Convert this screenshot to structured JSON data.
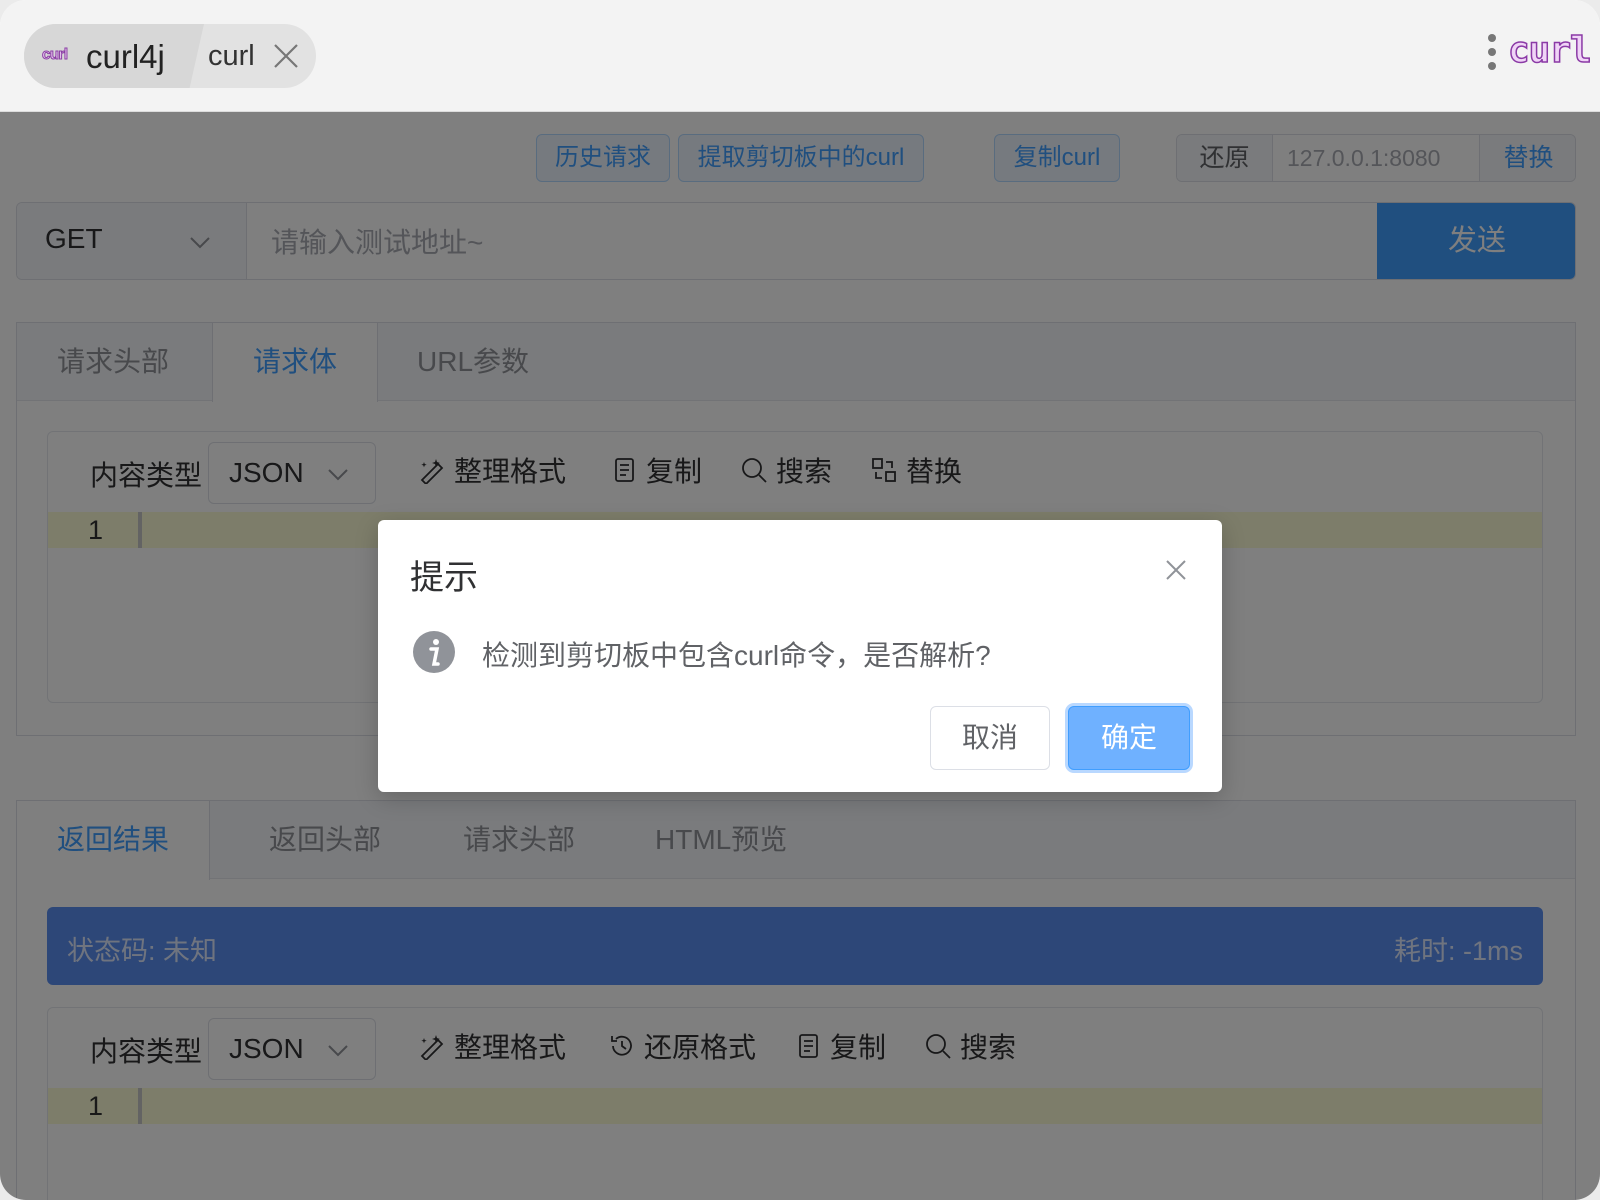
{
  "topbar": {
    "tab_logo": "curl",
    "tab_title": "curl4j",
    "tab_subtitle": "curl",
    "brand_logo": "curl"
  },
  "actions": {
    "history": "历史请求",
    "extract_clipboard": "提取剪切板中的curl",
    "copy_curl": "复制curl",
    "restore": "还原",
    "host_value": "127.0.0.1:8080",
    "replace": "替换"
  },
  "request": {
    "method": "GET",
    "url_placeholder": "请输入测试地址~",
    "send": "发送",
    "tabs": [
      "请求头部",
      "请求体",
      "URL参数"
    ],
    "active_tab": "请求体",
    "editor": {
      "content_type_label": "内容类型",
      "content_type": "JSON",
      "format": "整理格式",
      "copy": "复制",
      "search": "搜索",
      "replace": "替换",
      "line": "1"
    }
  },
  "response": {
    "tabs": [
      "返回结果",
      "返回头部",
      "请求头部",
      "HTML预览"
    ],
    "active_tab": "返回结果",
    "status": "状态码: 未知",
    "elapsed": "耗时: -1ms",
    "editor": {
      "content_type_label": "内容类型",
      "content_type": "JSON",
      "format": "整理格式",
      "restore_format": "还原格式",
      "copy": "复制",
      "search": "搜索",
      "line": "1"
    }
  },
  "dialog": {
    "title": "提示",
    "message": "检测到剪切板中包含curl命令，是否解析?",
    "cancel": "取消",
    "confirm": "确定"
  },
  "icons": [
    "close-icon",
    "more-vertical-icon",
    "chevron-down-icon",
    "magic-wand-icon",
    "document-copy-icon",
    "search-icon",
    "replace-icon",
    "history-icon",
    "info-icon"
  ]
}
